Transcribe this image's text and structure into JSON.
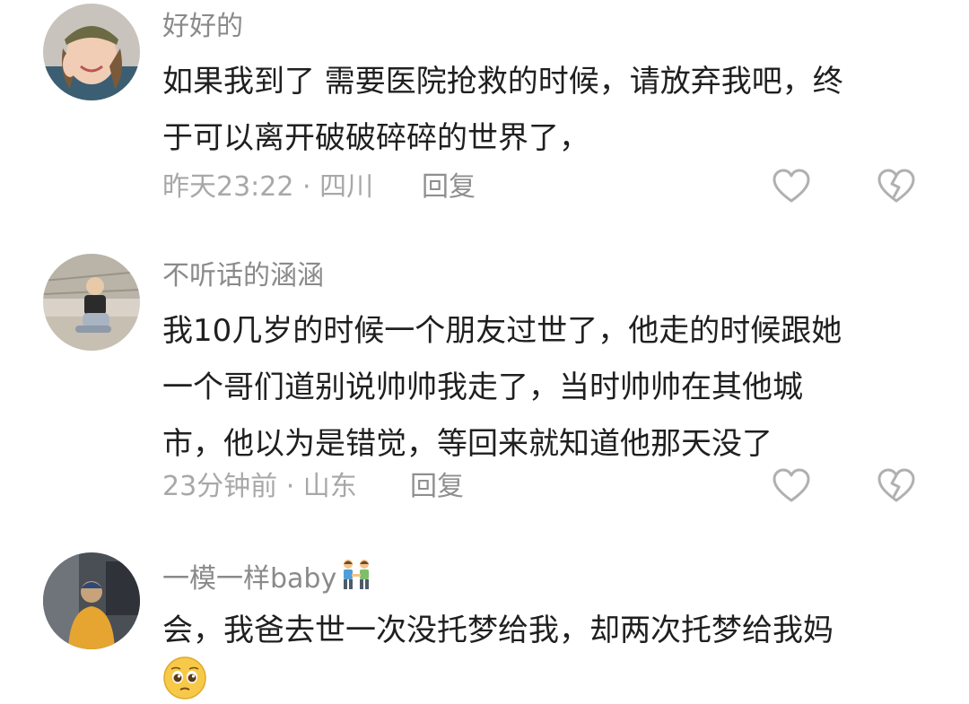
{
  "comments": [
    {
      "username": "好好的",
      "lines": [
        "如果我到了 需要医院抢救的时候，请放弃我吧，终",
        "于可以离开破破碎碎的世界了，"
      ],
      "time_location": "昨天23:22 · 四川",
      "reply_label": "回复",
      "like_icon": "heart-outline-icon",
      "dislike_icon": "broken-heart-icon"
    },
    {
      "username": "不听话的涵涵",
      "lines": [
        "我10几岁的时候一个朋友过世了，他走的时候跟她",
        "一个哥们道别说帅帅我走了，当时帅帅在其他城",
        "市，他以为是错觉，等回来就知道他那天没了"
      ],
      "time_location": "23分钟前 · 山东",
      "reply_label": "回复",
      "like_icon": "heart-outline-icon",
      "dislike_icon": "broken-heart-icon"
    },
    {
      "username": "一模一样baby",
      "username_emoji": "two-men-holding-hands-emoji",
      "lines": [
        "会，我爸去世一次没托梦给我，却两次托梦给我妈"
      ],
      "trailing_emoji": "pleading-face-emoji"
    }
  ],
  "colors": {
    "text": "#1f1f1f",
    "username": "#8a8a8a",
    "meta": "#a8a8a8",
    "icon": "#b0b0b0"
  }
}
